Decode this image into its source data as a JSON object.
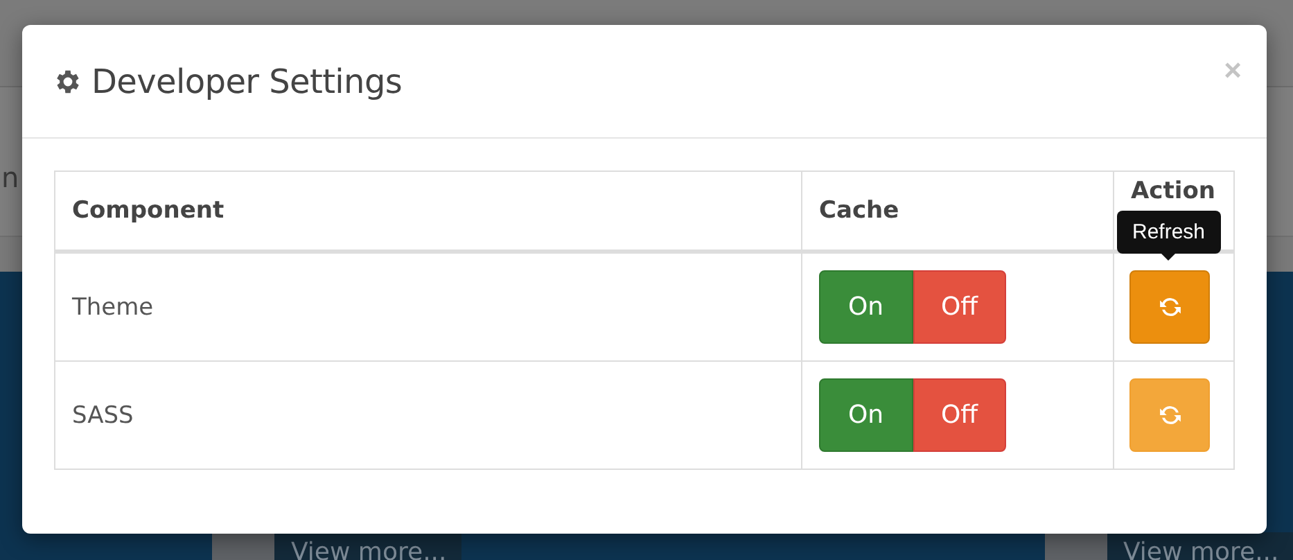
{
  "background": {
    "fragment": "n",
    "cards": [
      {
        "link": "View more..."
      },
      {
        "link": "View more..."
      }
    ]
  },
  "modal": {
    "title": "Developer Settings",
    "close": "×"
  },
  "table": {
    "columns": [
      "Component",
      "Cache",
      "Action"
    ],
    "rows": [
      {
        "component": "Theme",
        "on": "On",
        "off": "Off",
        "hovered": true
      },
      {
        "component": "SASS",
        "on": "On",
        "off": "Off",
        "hovered": false
      }
    ]
  },
  "tooltip": {
    "text": "Refresh"
  }
}
